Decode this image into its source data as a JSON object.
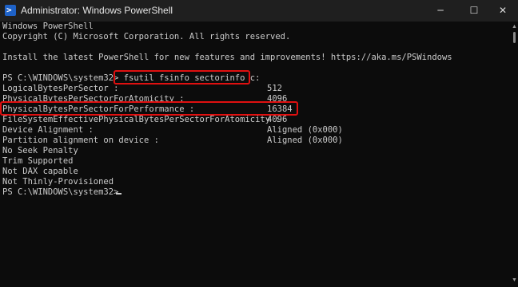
{
  "window": {
    "title": "Administrator: Windows PowerShell",
    "icon": "powershell-icon",
    "icon_glyph": ">",
    "controls": {
      "minimize": "─",
      "maximize": "☐",
      "close": "✕"
    }
  },
  "terminal": {
    "banner": [
      "Windows PowerShell",
      "Copyright (C) Microsoft Corporation. All rights reserved.",
      "",
      "Install the latest PowerShell for new features and improvements! https://aka.ms/PSWindows",
      ""
    ],
    "prompt": "PS C:\\WINDOWS\\system32> ",
    "command": "fsutil fsinfo sectorinfo c:",
    "output": [
      {
        "label": "LogicalBytesPerSector :",
        "value": "512"
      },
      {
        "label": "PhysicalBytesPerSectorForAtomicity :",
        "value": "4096"
      },
      {
        "label": "PhysicalBytesPerSectorForPerformance :",
        "value": "16384"
      },
      {
        "label": "FileSystemEffectivePhysicalBytesPerSectorForAtomicity :",
        "value": "4096"
      },
      {
        "label": "Device Alignment :",
        "value": "Aligned (0x000)"
      },
      {
        "label": "Partition alignment on device :",
        "value": "Aligned (0x000)"
      },
      {
        "label": "No Seek Penalty",
        "value": ""
      },
      {
        "label": "Trim Supported",
        "value": ""
      },
      {
        "label": "Not DAX capable",
        "value": ""
      },
      {
        "label": "Not Thinly-Provisioned",
        "value": ""
      }
    ],
    "final_prompt": "PS C:\\WINDOWS\\system32>",
    "colors": {
      "background": "#0c0c0c",
      "text": "#cccccc",
      "highlight": "#e01010",
      "titlebar": "#1f1f1f"
    }
  }
}
